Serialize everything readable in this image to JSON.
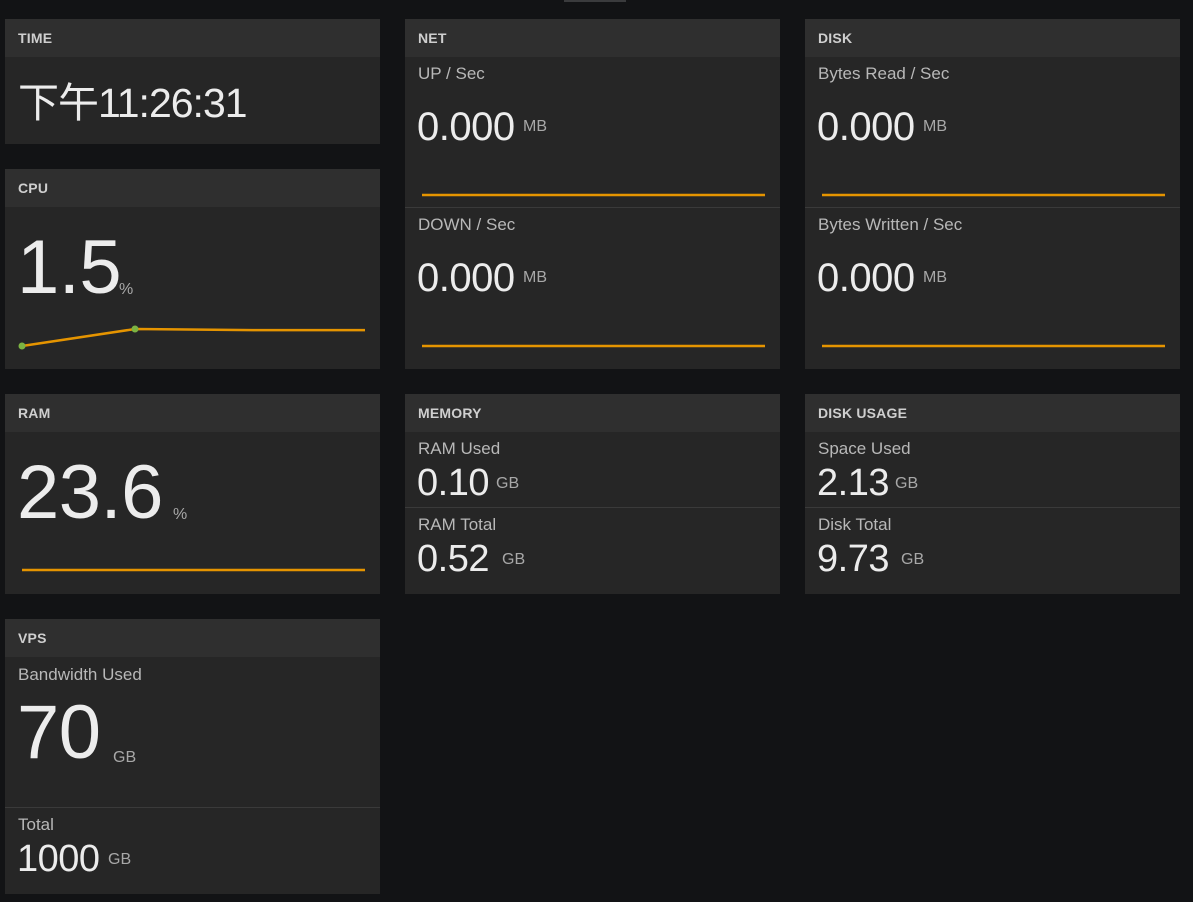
{
  "time": {
    "title": "TIME",
    "value": "下午11:26:31"
  },
  "cpu": {
    "title": "CPU",
    "value": "1.5",
    "unit": "%",
    "spark": [
      0.1,
      1.6,
      1.5,
      1.5
    ]
  },
  "ram": {
    "title": "RAM",
    "value": "23.6",
    "unit": "%",
    "spark": [
      23.6,
      23.6,
      23.6,
      23.6
    ]
  },
  "vps": {
    "title": "VPS",
    "used_label": "Bandwidth Used",
    "used_value": "70",
    "used_unit": "GB",
    "total_label": "Total",
    "total_value": "1000",
    "total_unit": "GB"
  },
  "net": {
    "title": "NET",
    "up_label": "UP / Sec",
    "up_value": "0.000",
    "up_unit": "MB",
    "down_label": "DOWN / Sec",
    "down_value": "0.000",
    "down_unit": "MB"
  },
  "disk": {
    "title": "DISK",
    "read_label": "Bytes Read / Sec",
    "read_value": "0.000",
    "read_unit": "MB",
    "write_label": "Bytes Written / Sec",
    "write_value": "0.000",
    "write_unit": "MB"
  },
  "memory": {
    "title": "MEMORY",
    "used_label": "RAM Used",
    "used_value": "0.10",
    "used_unit": "GB",
    "total_label": "RAM Total",
    "total_value": "0.52",
    "total_unit": "GB"
  },
  "disk_usage": {
    "title": "DISK USAGE",
    "used_label": "Space Used",
    "used_value": "2.13",
    "used_unit": "GB",
    "total_label": "Disk Total",
    "total_value": "9.73",
    "total_unit": "GB"
  },
  "colors": {
    "background": "#121315",
    "panel": "#262626",
    "header": "#2f2f2f",
    "line": "#e59400",
    "point": "#7cb342"
  }
}
